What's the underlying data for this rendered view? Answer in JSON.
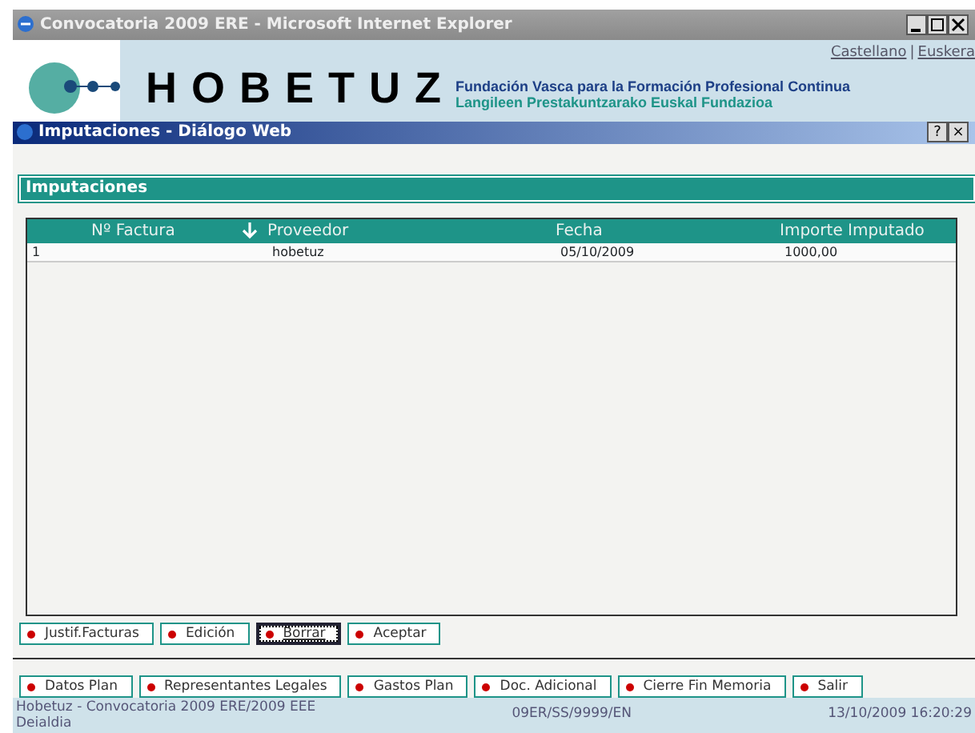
{
  "browser_window": {
    "title": "Convocatoria 2009 ERE - Microsoft Internet Explorer"
  },
  "header": {
    "languages": [
      "Castellano",
      "Euskera"
    ],
    "language_separator": "|",
    "brand": "HOBETUZ",
    "tagline_es": "Fundación Vasca para la Formación Profesional Continua",
    "tagline_eu": "Langileen Prestakuntzarako Euskal Fundazioa"
  },
  "dialog": {
    "title": "Imputaciones - Diálogo Web",
    "help": "?",
    "close": "×"
  },
  "section_title": "Imputaciones",
  "table": {
    "columns": [
      {
        "label": "Nº Factura",
        "sorted": false
      },
      {
        "label": "Proveedor",
        "sorted": true
      },
      {
        "label": "Fecha",
        "sorted": false
      },
      {
        "label": "Importe Imputado",
        "sorted": false
      }
    ],
    "rows": [
      [
        "1",
        "hobetuz",
        "05/10/2009",
        "1000,00"
      ]
    ]
  },
  "dialog_buttons": [
    {
      "label": "Justif.Facturas",
      "focused": false
    },
    {
      "label": "Edición",
      "focused": false
    },
    {
      "label": "Borrar",
      "focused": true
    },
    {
      "label": "Aceptar",
      "focused": false
    }
  ],
  "page_buttons": [
    {
      "label": "Datos Plan",
      "focused": false
    },
    {
      "label": "Representantes Legales",
      "focused": false
    },
    {
      "label": "Gastos Plan",
      "focused": false
    },
    {
      "label": "Doc. Adicional",
      "focused": false
    },
    {
      "label": "Cierre Fin Memoria",
      "focused": false
    },
    {
      "label": "Salir",
      "focused": false
    }
  ],
  "status_bar": {
    "left": "Hobetuz - Convocatoria 2009 ERE/2009 EEE",
    "left_second_line": "Deialdia",
    "center": "09ER/SS/9999/EN",
    "right": "13/10/2009 16:20:29"
  }
}
